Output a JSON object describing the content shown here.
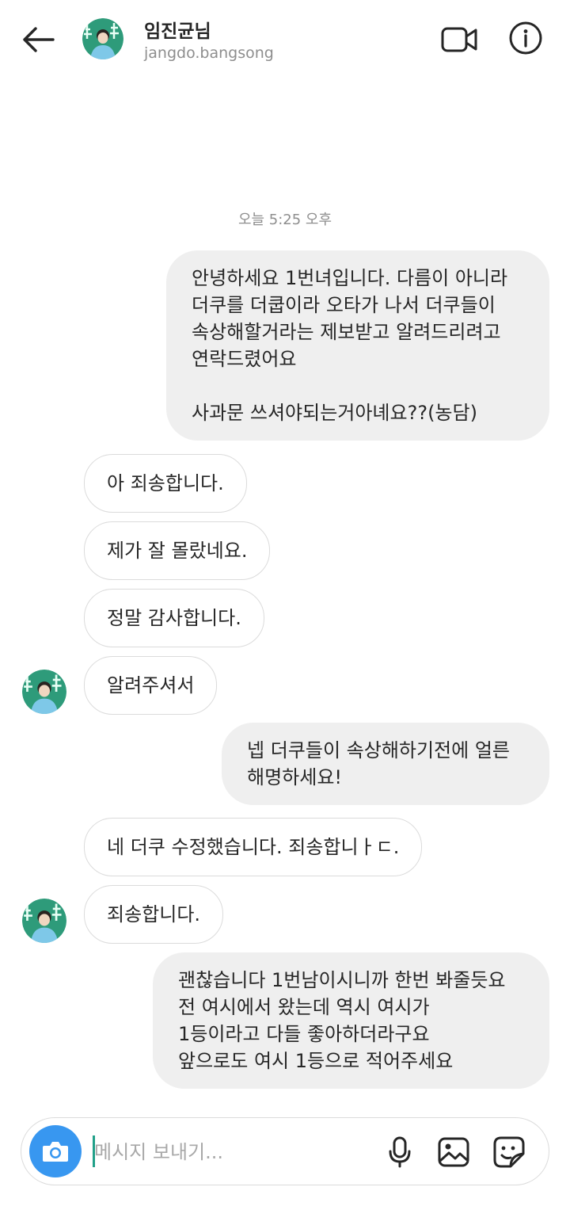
{
  "header": {
    "name": "임진균님",
    "username": "jangdo.bangsong"
  },
  "timestamp": "오늘 5:25 오후",
  "messages": [
    {
      "from": "me",
      "text": "안녕하세요 1번녀입니다. 다름이 아니라\n더쿠를 더쿱이라 오타가 나서 더쿠들이\n속상해할거라는 제보받고 알려드리려고\n연락드렸어요\n\n사과문 쓰셔야되는거아녜요??(농담)"
    },
    {
      "from": "them",
      "text": "아 죄송합니다."
    },
    {
      "from": "them",
      "text": "제가 잘 몰랐네요."
    },
    {
      "from": "them",
      "text": "정말 감사합니다."
    },
    {
      "from": "them",
      "text": "알려주셔서"
    },
    {
      "from": "me",
      "text": "넵 더쿠들이 속상해하기전에 얼른\n해명하세요!"
    },
    {
      "from": "them",
      "text": "네 더쿠 수정했습니다. 죄송합니ㅏㄷ."
    },
    {
      "from": "them",
      "text": "죄송합니다."
    },
    {
      "from": "me",
      "text": "괜찮습니다 1번남이시니까 한번 봐줄듯요\n전 여시에서 왔는데  역시 여시가\n1등이라고 다들 좋아하더라구요\n앞으로도 여시 1등으로 적어주세요"
    }
  ],
  "composer": {
    "placeholder": "메시지 보내기..."
  },
  "icons": {
    "back": "arrow-left-icon",
    "video": "video-camera-icon",
    "info": "info-icon",
    "camera": "camera-icon",
    "mic": "microphone-icon",
    "gallery": "image-icon",
    "sticker": "sticker-icon"
  },
  "colors": {
    "accent_blue": "#3897f0",
    "my_bubble": "#efefef",
    "avatar_green": "#2e9b7a",
    "caret": "#21a089"
  }
}
